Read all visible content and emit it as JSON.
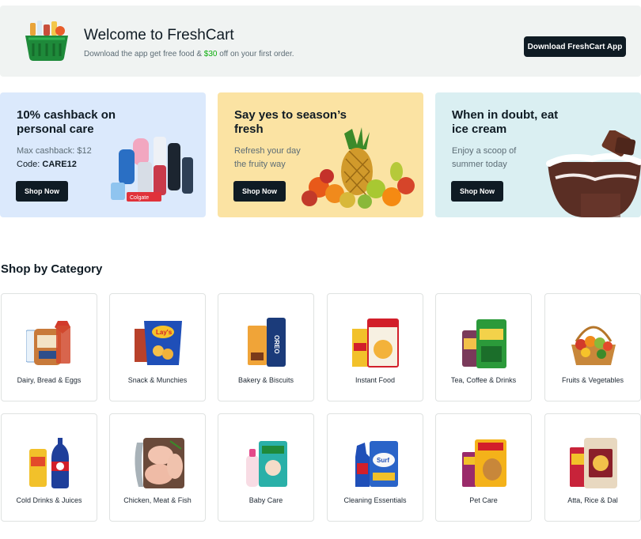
{
  "welcome": {
    "title": "Welcome to FreshCart",
    "subtitle_prefix": "Download the app get free food & ",
    "subtitle_accent": "$30",
    "subtitle_suffix": " off on your first order.",
    "download_label": "Download FreshCart App"
  },
  "promos": [
    {
      "title": "10% cashback on personal care",
      "line1": "Max cashback: $12",
      "line2_prefix": "Code: ",
      "line2_code": "CARE12",
      "button": "Shop Now",
      "bg": "#dbe9fc"
    },
    {
      "title": "Say yes to season’s fresh",
      "line1": "Refresh your day",
      "line2": "the fruity way",
      "button": "Shop Now",
      "bg": "#fbe3a3"
    },
    {
      "title": "When in doubt, eat ice cream",
      "line1": "Enjoy a scoop of",
      "line2": "summer today",
      "button": "Shop Now",
      "bg": "#daeff2"
    }
  ],
  "categories_title": "Shop by Category",
  "categories": [
    {
      "label": "Dairy, Bread & Eggs",
      "icon": "dairy-bread-icon"
    },
    {
      "label": "Snack & Munchies",
      "icon": "snack-chips-icon"
    },
    {
      "label": "Bakery & Biscuits",
      "icon": "biscuits-icon"
    },
    {
      "label": "Instant Food",
      "icon": "instant-food-icon"
    },
    {
      "label": "Tea, Coffee & Drinks",
      "icon": "tea-coffee-icon"
    },
    {
      "label": "Fruits & Vegetables",
      "icon": "fruit-basket-icon"
    },
    {
      "label": "Cold Drinks & Juices",
      "icon": "cold-drinks-icon"
    },
    {
      "label": "Chicken, Meat & Fish",
      "icon": "meat-fish-icon"
    },
    {
      "label": "Baby Care",
      "icon": "baby-care-icon"
    },
    {
      "label": "Cleaning Essentials",
      "icon": "cleaning-icon"
    },
    {
      "label": "Pet Care",
      "icon": "pet-food-icon"
    },
    {
      "label": "Atta, Rice & Dal",
      "icon": "atta-rice-icon"
    }
  ],
  "colors": {
    "accent_green": "#0aad0a",
    "dark_button": "#0f1b24",
    "banner_bg": "#f0f3f2"
  }
}
